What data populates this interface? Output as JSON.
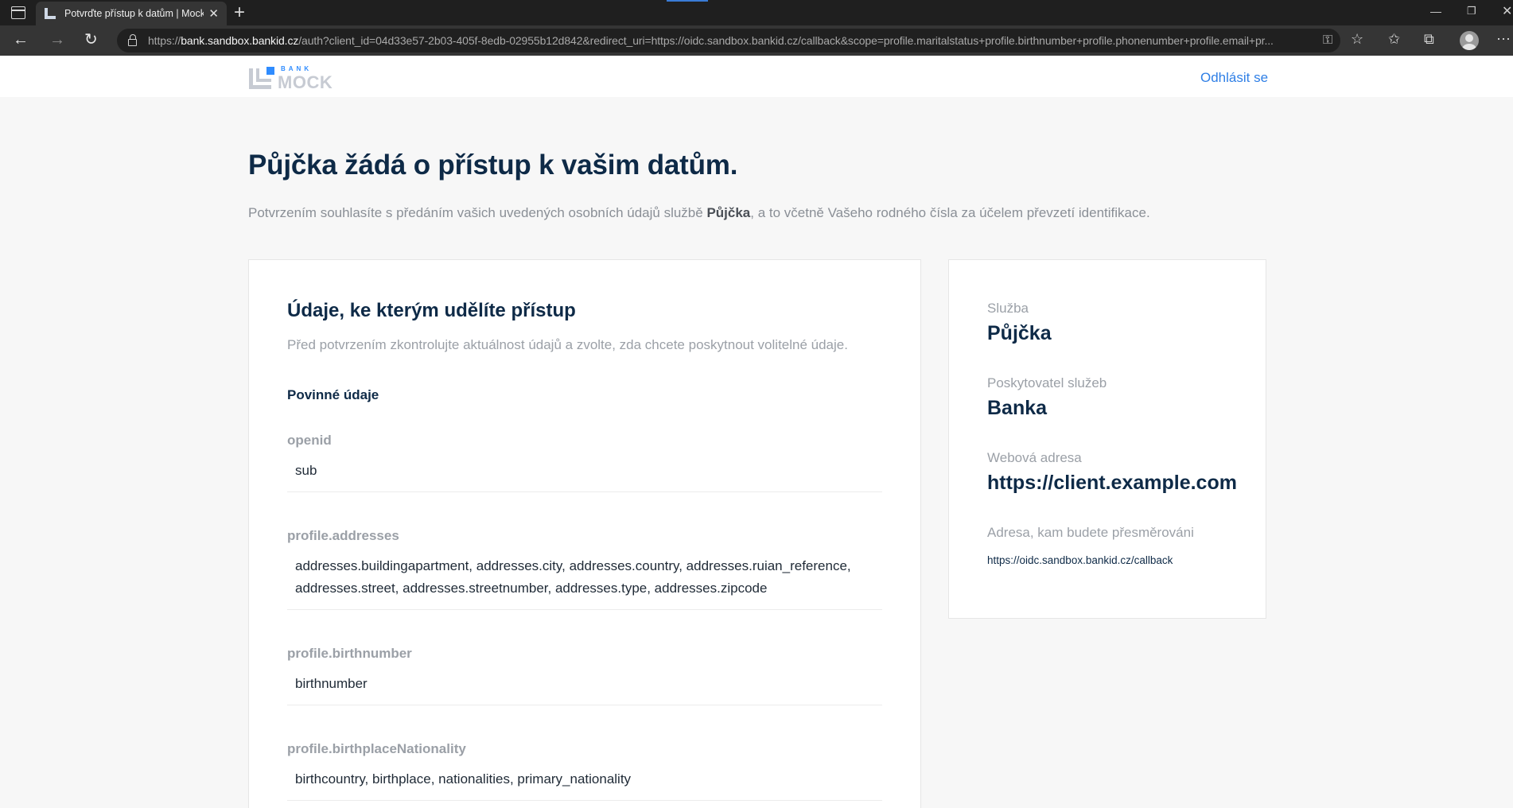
{
  "browser": {
    "tab_title": "Potvrďte přístup k datům | Mock",
    "url_prefix": "https://",
    "url_host": "bank.sandbox.bankid.cz",
    "url_rest": "/auth?client_id=04d33e57-2b03-405f-8edb-02955b12d842&redirect_uri=https://oidc.sandbox.bankid.cz/callback&scope=profile.maritalstatus+profile.birthnumber+profile.phonenumber+profile.email+pr...",
    "icons": [
      "tab-actions-icon",
      "close-icon",
      "plus-icon",
      "back-icon",
      "forward-icon",
      "refresh-icon",
      "lock-icon",
      "key-icon",
      "favorite-add-icon",
      "favorites-icon",
      "collections-icon",
      "profile-icon",
      "more-icon",
      "minimize-icon",
      "restore-icon"
    ]
  },
  "header": {
    "logo_bank": "BANK",
    "logo_mock": "MOCK",
    "logout_label": "Odhlásit se"
  },
  "main": {
    "title": "Půjčka žádá o přístup k vašim datům.",
    "lead_before": "Potvrzením souhlasíte s předáním vašich uvedených osobních údajů službě ",
    "lead_service": "Půjčka",
    "lead_after": ", a to včetně Vašeho rodného čísla za účelem převzetí identifikace."
  },
  "consent": {
    "title": "Údaje, ke kterým udělíte přístup",
    "subtitle": "Před potvrzením zkontrolujte aktuálnost údajů a zvolte, zda chcete poskytnout volitelné údaje.",
    "required_label": "Povinné údaje",
    "scopes": [
      {
        "name": "openid",
        "claims": "sub"
      },
      {
        "name": "profile.addresses",
        "claims": "addresses.buildingapartment, addresses.city, addresses.country, addresses.ruian_reference, addresses.street, addresses.streetnumber, addresses.type, addresses.zipcode"
      },
      {
        "name": "profile.birthnumber",
        "claims": "birthnumber"
      },
      {
        "name": "profile.birthplaceNationality",
        "claims": "birthcountry, birthplace, nationalities, primary_nationality"
      }
    ]
  },
  "service_info": {
    "service_label": "Služba",
    "service_value": "Půjčka",
    "provider_label": "Poskytovatel služeb",
    "provider_value": "Banka",
    "web_label": "Webová adresa",
    "web_value": "https://client.example.com",
    "redirect_label": "Adresa, kam budete přesměrováni",
    "redirect_value": "https://oidc.sandbox.bankid.cz/callback"
  }
}
